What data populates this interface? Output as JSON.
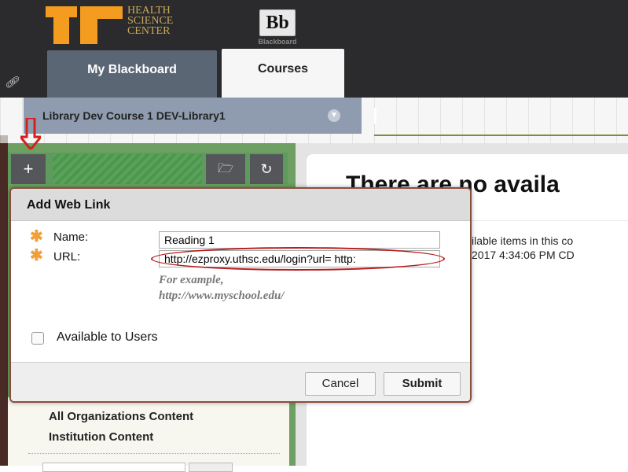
{
  "header": {
    "institution_logo_lines": [
      "HEALTH",
      "SCIENCE",
      "CENTER"
    ],
    "blackboard_logo": {
      "mark": "Bb",
      "word": "Blackboard"
    },
    "tabs": [
      {
        "label": "My Blackboard",
        "selected": false
      },
      {
        "label": "Courses",
        "selected": true
      }
    ],
    "colors": {
      "background": "#2b2b2d",
      "logo_orange": "#f39c1f",
      "logo_gold": "#c9a95b"
    }
  },
  "course_bar": {
    "course_title": "Library Dev Course 1 DEV-Library1"
  },
  "sidebar": {
    "toolbar": {
      "add_icon": "+",
      "folder_icon": "folder-icon",
      "refresh_icon": "refresh-icon"
    },
    "items": [
      {
        "label": "All Organizations Content"
      },
      {
        "label": "Institution Content"
      }
    ]
  },
  "main": {
    "heading": "There are no availa",
    "line1": "ilable items in this co",
    "line2": "2017 4:34:06 PM CD"
  },
  "modal": {
    "title": "Add Web Link",
    "fields": {
      "name": {
        "label": "Name:",
        "value": "Reading 1",
        "required": true
      },
      "url": {
        "label": "URL:",
        "value": "http://ezproxy.uthsc.edu/login?url= http:",
        "required": true
      }
    },
    "example_line1": "For example,",
    "example_line2": "http://www.myschool.edu/",
    "available_to_users": {
      "label": "Available to Users",
      "checked": false
    },
    "buttons": {
      "cancel": "Cancel",
      "submit": "Submit"
    },
    "colors": {
      "required_star": "#f0a03a",
      "annotation_red": "#b71c1c"
    }
  }
}
